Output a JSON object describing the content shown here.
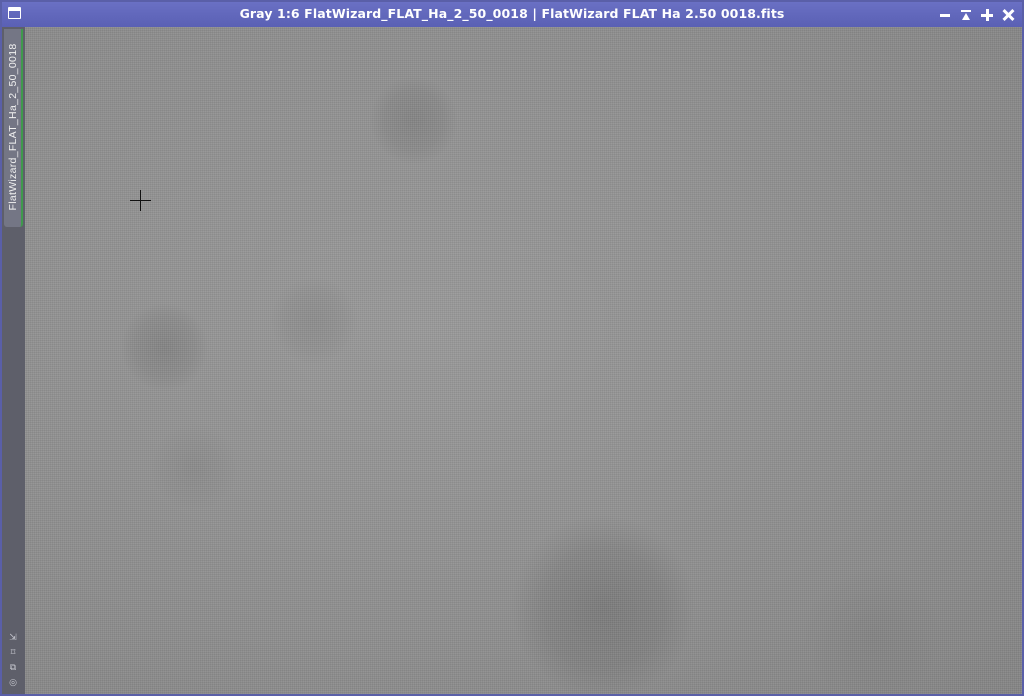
{
  "window": {
    "title": "Gray 1:6 FlatWizard_FLAT_Ha_2_50_0018 | FlatWizard FLAT Ha 2.50 0018.fits",
    "controls": [
      "shade-icon",
      "maximize-icon",
      "iconize-icon",
      "close-icon"
    ]
  },
  "side_tab": {
    "label": "FlatWizard_FLAT_Ha_2_50_0018"
  },
  "strip_icons": [
    "fit-view-icon",
    "zoom-icon",
    "clone-icon",
    "settings-icon"
  ],
  "colors": {
    "titlebar": "#5a60b4",
    "side_tab_accent": "#3f9a4c",
    "image_background": "#929292"
  }
}
